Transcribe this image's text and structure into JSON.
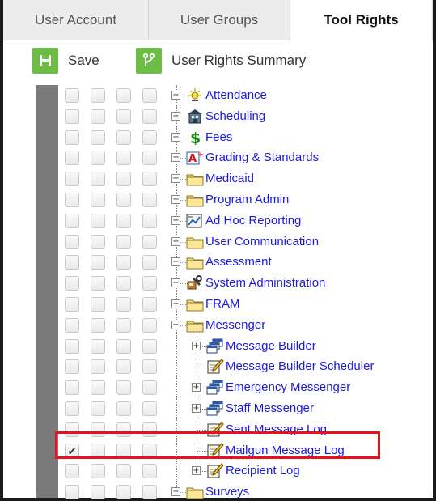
{
  "tabs": [
    {
      "label": "User Account",
      "active": false
    },
    {
      "label": "User Groups",
      "active": false
    },
    {
      "label": "Tool Rights",
      "active": true
    }
  ],
  "toolbar": {
    "save_label": "Save",
    "summary_label": "User Rights Summary",
    "accent_color": "#6cbd45"
  },
  "tree": [
    {
      "label": "Attendance",
      "icon": "attendance-icon",
      "expander": "+",
      "checked": false
    },
    {
      "label": "Scheduling",
      "icon": "scheduling-icon",
      "expander": "+",
      "checked": false
    },
    {
      "label": "Fees",
      "icon": "fees-icon",
      "expander": "+",
      "checked": false
    },
    {
      "label": "Grading & Standards",
      "icon": "grading-icon",
      "expander": "+",
      "checked": false
    },
    {
      "label": "Medicaid",
      "icon": "folder-icon",
      "expander": "+",
      "checked": false
    },
    {
      "label": "Program Admin",
      "icon": "folder-icon",
      "expander": "+",
      "checked": false
    },
    {
      "label": "Ad Hoc Reporting",
      "icon": "ad-hoc-reporting-icon",
      "expander": "+",
      "checked": false
    },
    {
      "label": "User Communication",
      "icon": "folder-icon",
      "expander": "+",
      "checked": false
    },
    {
      "label": "Assessment",
      "icon": "folder-icon",
      "expander": "+",
      "checked": false
    },
    {
      "label": "System Administration",
      "icon": "system-administration-icon",
      "expander": "+",
      "checked": false
    },
    {
      "label": "FRAM",
      "icon": "folder-icon",
      "expander": "+",
      "checked": false
    },
    {
      "label": "Messenger",
      "icon": "folder-icon",
      "expander": "−",
      "checked": false
    },
    {
      "label": "Message Builder",
      "icon": "stacked-windows-icon",
      "expander": "+",
      "checked": false
    },
    {
      "label": "Message Builder Scheduler",
      "icon": "notepad-icon",
      "expander": "",
      "checked": false
    },
    {
      "label": "Emergency Messenger",
      "icon": "stacked-windows-icon",
      "expander": "+",
      "checked": false
    },
    {
      "label": "Staff Messenger",
      "icon": "stacked-windows-icon",
      "expander": "+",
      "checked": false
    },
    {
      "label": "Sent Message Log",
      "icon": "notepad-icon",
      "expander": "",
      "checked": false
    },
    {
      "label": "Mailgun Message Log",
      "icon": "notepad-icon",
      "expander": "",
      "checked": true,
      "highlighted": true
    },
    {
      "label": "Recipient Log",
      "icon": "notepad-icon",
      "expander": "+",
      "checked": false
    },
    {
      "label": "Surveys",
      "icon": "folder-icon",
      "expander": "+",
      "checked": false
    }
  ],
  "highlight_color": "#e8121c"
}
